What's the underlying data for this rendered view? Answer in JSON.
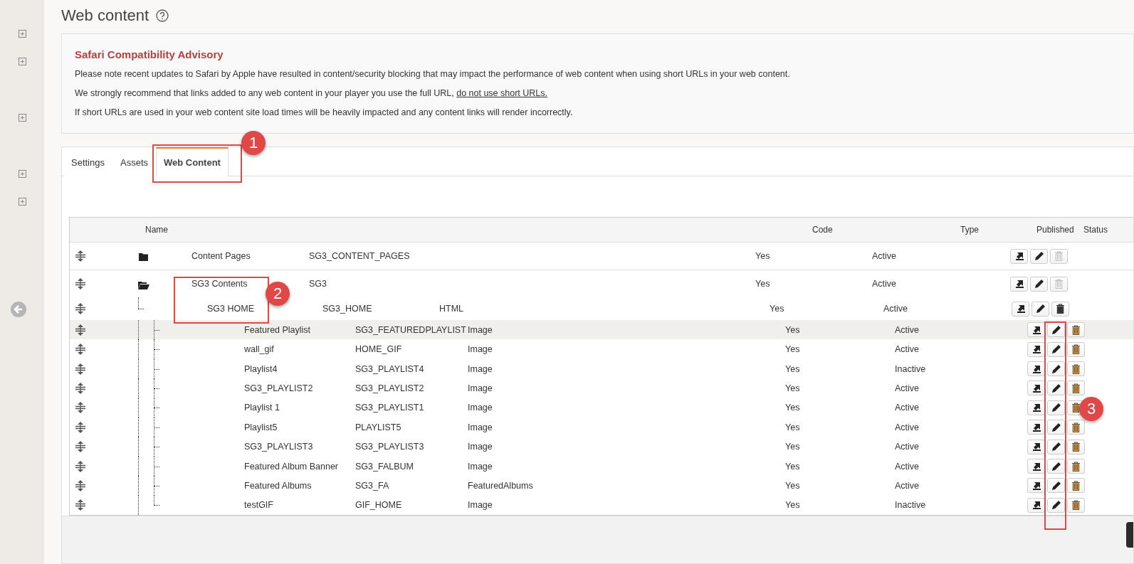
{
  "page": {
    "title": "Web content"
  },
  "advisory": {
    "title": "Safari Compatibility Advisory",
    "paragraphs": [
      {
        "text": "Please note recent updates to Safari by Apple have resulted in content/security blocking that may impact the performance of web content when using short URLs in your web content."
      },
      {
        "text": "We strongly recommend that links added to any web content in your player you use the full URL,",
        "link": "do not use short URLs."
      },
      {
        "text": "If short URLs are used in your web content site load times will be heavily impacted and any content links will render incorrectly."
      }
    ]
  },
  "tabs": [
    {
      "label": "Settings",
      "selected": false
    },
    {
      "label": "Assets",
      "selected": false
    },
    {
      "label": "Web Content",
      "selected": true
    }
  ],
  "table": {
    "columns": [
      "Name",
      "Code",
      "Type",
      "Published",
      "Status"
    ],
    "rows": [
      {
        "name": "Content Pages",
        "code": "SG3_CONTENT_PAGES",
        "published": "Yes",
        "status": "Active",
        "expanded": false,
        "delete_disabled": true
      },
      {
        "name": "SG3 Contents",
        "code": "SG3",
        "published": "Yes",
        "status": "Active",
        "expanded": true,
        "delete_disabled": true,
        "children": [
          {
            "name": "SG3 HOME",
            "code": "SG3_HOME",
            "type": "HTML",
            "published": "Yes",
            "status": "Active",
            "delete_disabled": false,
            "children": [
              {
                "name": "Featured Playlist",
                "code": "SG3_FEATUREDPLAYLIST",
                "type": "Image",
                "published": "Yes",
                "status": "Active",
                "highlighted": true
              },
              {
                "name": "wall_gif",
                "code": "HOME_GIF",
                "type": "Image",
                "published": "Yes",
                "status": "Active",
                "highlighted": false
              },
              {
                "name": "Playlist4",
                "code": "SG3_PLAYLIST4",
                "type": "Image",
                "published": "Yes",
                "status": "Inactive",
                "highlighted": false
              },
              {
                "name": "SG3_PLAYLIST2",
                "code": "SG3_PLAYLIST2",
                "type": "Image",
                "published": "Yes",
                "status": "Active",
                "highlighted": false
              },
              {
                "name": "Playlist 1",
                "code": "SG3_PLAYLIST1",
                "type": "Image",
                "published": "Yes",
                "status": "Active",
                "highlighted": false
              },
              {
                "name": "Playlist5",
                "code": "PLAYLIST5",
                "type": "Image",
                "published": "Yes",
                "status": "Active",
                "highlighted": false
              },
              {
                "name": "SG3_PLAYLIST3",
                "code": "SG3_PLAYLIST3",
                "type": "Image",
                "published": "Yes",
                "status": "Active",
                "highlighted": false
              },
              {
                "name": "Featured Album Banner",
                "code": "SG3_FALBUM",
                "type": "Image",
                "published": "Yes",
                "status": "Active",
                "highlighted": false
              },
              {
                "name": "Featured Albums",
                "code": "SG3_FA",
                "type": "FeaturedAlbums",
                "published": "Yes",
                "status": "Active",
                "highlighted": false
              },
              {
                "name": "testGIF",
                "code": "GIF_HOME",
                "type": "Image",
                "published": "Yes",
                "status": "Inactive",
                "highlighted": false
              }
            ]
          }
        ]
      }
    ]
  },
  "annotations": [
    {
      "number": "1"
    },
    {
      "number": "2"
    },
    {
      "number": "3"
    }
  ]
}
